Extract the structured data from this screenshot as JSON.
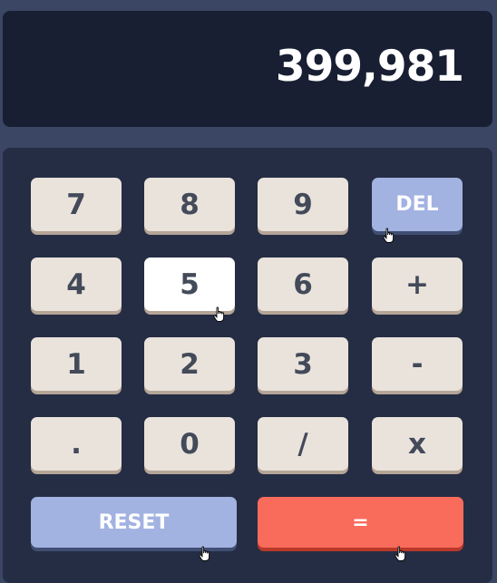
{
  "display": {
    "value": "399,981"
  },
  "keys": {
    "k7": "7",
    "k8": "8",
    "k9": "9",
    "del": "DEL",
    "k4": "4",
    "k5": "5",
    "k6": "6",
    "plus": "+",
    "k1": "1",
    "k2": "2",
    "k3": "3",
    "minus": "-",
    "dot": ".",
    "k0": "0",
    "divide": "/",
    "multiply": "x",
    "reset": "RESET",
    "equals": "="
  },
  "colors": {
    "background": "#3b4664",
    "screen": "#181f33",
    "keypad": "#252d44",
    "key": "#eae3dc",
    "key_shadow": "#b4a597",
    "key_text": "#434a59",
    "accent_blue": "#a2b2e1",
    "accent_red": "#f96b5b"
  },
  "icons": {
    "cursor": "hand-pointer-icon"
  }
}
